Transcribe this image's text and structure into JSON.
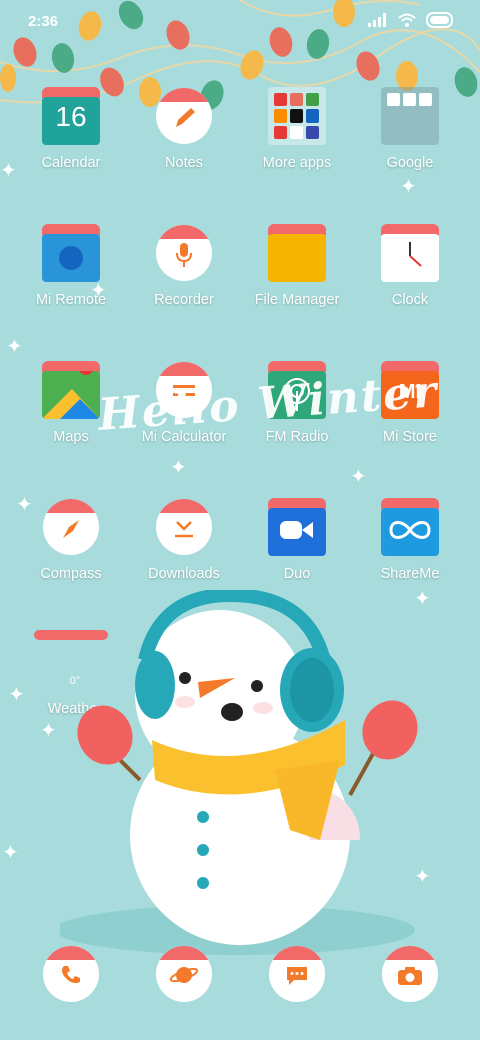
{
  "status_bar": {
    "time": "2:36",
    "icons": [
      "signal-icon",
      "wifi-icon",
      "battery-icon"
    ]
  },
  "wallpaper": {
    "greeting": "Hello Winter"
  },
  "apps": [
    {
      "label": "Calendar",
      "icon": "calendar-icon",
      "date": "16"
    },
    {
      "label": "Notes",
      "icon": "notes-icon"
    },
    {
      "label": "More apps",
      "icon": "folder-icon"
    },
    {
      "label": "Google",
      "icon": "folder-icon"
    },
    {
      "label": "Mi Remote",
      "icon": "remote-icon"
    },
    {
      "label": "Recorder",
      "icon": "microphone-icon"
    },
    {
      "label": "File Manager",
      "icon": "folder-icon"
    },
    {
      "label": "Clock",
      "icon": "clock-icon"
    },
    {
      "label": "Maps",
      "icon": "maps-icon"
    },
    {
      "label": "Mi Calculator",
      "icon": "calculator-icon"
    },
    {
      "label": "FM Radio",
      "icon": "radio-icon"
    },
    {
      "label": "Mi Store",
      "icon": "mi-store-icon",
      "logo_text": "MI"
    },
    {
      "label": "Compass",
      "icon": "compass-icon"
    },
    {
      "label": "Downloads",
      "icon": "download-icon"
    },
    {
      "label": "Duo",
      "icon": "video-camera-icon"
    },
    {
      "label": "ShareMe",
      "icon": "infinity-icon"
    }
  ],
  "weather_widget": {
    "temperature": "0°",
    "label": "Weather"
  },
  "dock": [
    {
      "icon": "phone-icon"
    },
    {
      "icon": "browser-planet-icon"
    },
    {
      "icon": "messages-icon"
    },
    {
      "icon": "camera-icon"
    }
  ],
  "colors": {
    "background": "#a8dcdc",
    "accent_red": "#f2696a",
    "orange": "#f47a2b",
    "yellow": "#f4b400",
    "blue": "#1e88e5"
  }
}
